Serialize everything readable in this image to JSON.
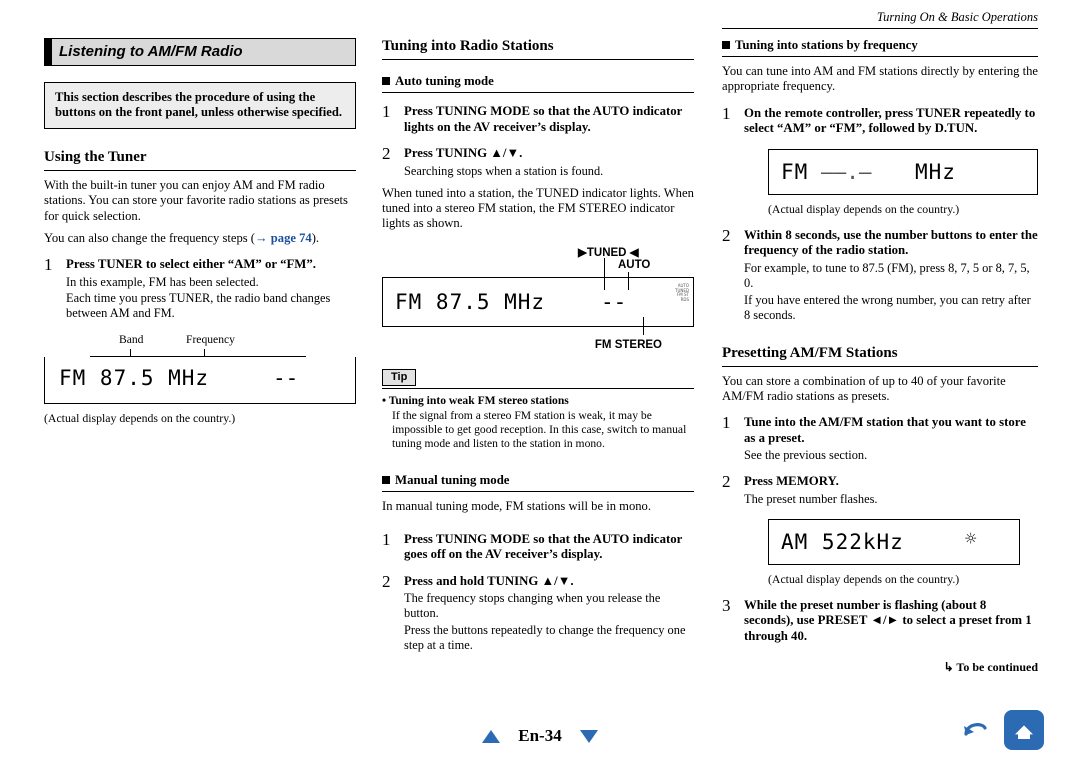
{
  "header": {
    "running_head": "Turning On & Basic Operations"
  },
  "col1": {
    "title": "Listening to AM/FM Radio",
    "note": "This section describes the procedure of using the buttons on the front panel, unless otherwise specified.",
    "section_heading": "Using the Tuner",
    "intro1": "With the built-in tuner you can enjoy AM and FM radio stations. You can store your favorite radio stations as presets for quick selection.",
    "intro2_pre": "You can also change the frequency steps (",
    "intro2_arrow": "→ ",
    "intro2_link": "page 74",
    "intro2_post": ").",
    "step1_num": "1",
    "step1_head": "Press TUNER to select either “AM” or “FM”.",
    "step1_sub1": "In this example, FM has been selected.",
    "step1_sub2": "Each time you press TUNER, the radio band changes between AM and FM.",
    "fig_label_band": "Band",
    "fig_label_freq": "Frequency",
    "fig_display": "FM  87.5 MHz",
    "fig_display_dash": "--",
    "fig_caption": "(Actual display depends on the country.)"
  },
  "col2": {
    "title": "Tuning into Radio Stations",
    "sub1": "Auto tuning mode",
    "step1_num": "1",
    "step1_head": "Press TUNING MODE so that the AUTO indicator lights on the AV receiver’s display.",
    "step2_num": "2",
    "step2_head": "Press TUNING ▲/▼.",
    "step2_sub": "Searching stops when a station is found.",
    "para1": "When tuned into a station, the TUNED indicator lights. When tuned into a stereo FM station, the FM STEREO indicator lights as shown.",
    "fig_tuned": "TUNED",
    "fig_auto": "AUTO",
    "fig_display": "FM  87.5 MHz",
    "fig_display_dash": "--",
    "fig_fmstereo": "FM STEREO",
    "tip_tag": "Tip",
    "tip_head": "Tuning into weak FM stereo stations",
    "tip_body": "If the signal from a stereo FM station is weak, it may be impossible to get good reception. In this case, switch to manual tuning mode and listen to the station in mono.",
    "sub2": "Manual tuning mode",
    "para2": "In manual tuning mode, FM stations will be in mono.",
    "mstep1_num": "1",
    "mstep1_head": "Press TUNING MODE so that the AUTO indicator goes off on the AV receiver’s display.",
    "mstep2_num": "2",
    "mstep2_head": "Press and hold TUNING ▲/▼.",
    "mstep2_sub1": "The frequency stops changing when you release the button.",
    "mstep2_sub2": "Press the buttons repeatedly to change the frequency one step at a time."
  },
  "col3": {
    "sub1": "Tuning into stations by frequency",
    "para1": "You can tune into AM and FM stations directly by entering the appropriate frequency.",
    "step1_num": "1",
    "step1_head": "On the remote controller, press TUNER repeatedly to select “AM” or “FM”, followed by D.TUN.",
    "fig1_display": "FM",
    "fig1_mhz": "MHz",
    "fig1_caption": "(Actual display depends on the country.)",
    "step2_num": "2",
    "step2_head": "Within 8 seconds, use the number buttons to enter the frequency of the radio station.",
    "step2_sub1": "For example, to tune to 87.5 (FM), press 8, 7, 5 or 8, 7, 5, 0.",
    "step2_sub2": "If you have entered the wrong number, you can retry after 8 seconds.",
    "title2": "Presetting AM/FM Stations",
    "para2": "You can store a combination of up to 40 of your favorite AM/FM radio stations as presets.",
    "pstep1_num": "1",
    "pstep1_head": "Tune into the AM/FM station that you want to store as a preset.",
    "pstep1_sub": "See the previous section.",
    "pstep2_num": "2",
    "pstep2_head": "Press MEMORY.",
    "pstep2_sub": "The preset number flashes.",
    "fig2_display": "AM   522kHz",
    "fig2_caption": "(Actual display depends on the country.)",
    "pstep3_num": "3",
    "pstep3_head": "While the preset number is flashing (about 8 seconds), use PRESET ◄/► to select a preset from 1 through 40.",
    "to_be_continued": "↳ To be continued"
  },
  "footer": {
    "page_label": "En-34",
    "up_triangle_icon": "triangle-up-icon",
    "down_triangle_icon": "triangle-down-icon",
    "back_icon": "back-arrow-icon",
    "home_icon": "home-icon"
  },
  "colors": {
    "accent_blue": "#2d6ab4",
    "link_blue": "#1d4f9e",
    "title_bar_bg": "#d9d9d9",
    "note_bg": "#ededed"
  }
}
